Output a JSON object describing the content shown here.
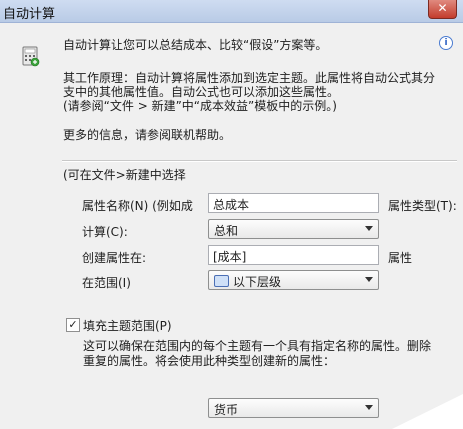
{
  "window": {
    "title": "自动计算",
    "close_glyph": "✕"
  },
  "intro": "自动计算让您可以总结成本、比较“假设”方案等。",
  "info_icon": "i",
  "principle": {
    "line1": "其工作原理：自动计算将属性添加到选定主题。此属性将自动公式其分",
    "line2": "支中的其他属性值。自动公式也可以添加这些属性。",
    "line3": "(请参阅“文件 > 新建”中“成本效益”模板中的示例。)"
  },
  "more_info": "更多的信息，请参阅联机帮助。",
  "section_title": "(可在文件>新建中选择",
  "form": {
    "name_label": "属性名称(N) (例如成",
    "name_value": "总成本",
    "type_label": "属性类型(T):",
    "calc_label": "计算(C):",
    "calc_value": "总和",
    "create_label": "创建属性在:",
    "create_value": "[成本]",
    "create_suffix": "属性",
    "scope_label": "在范围(I)",
    "scope_value": "以下层级"
  },
  "fill": {
    "checked": true,
    "check_glyph": "✓",
    "label": "填充主题范围(P)",
    "desc_line1": "这可以确保在范围内的每个主题有一个具有指定名称的属性。删除",
    "desc_line2": "重复的属性。将会使用此种类型创建新的属性："
  },
  "type_select_value": "货币"
}
